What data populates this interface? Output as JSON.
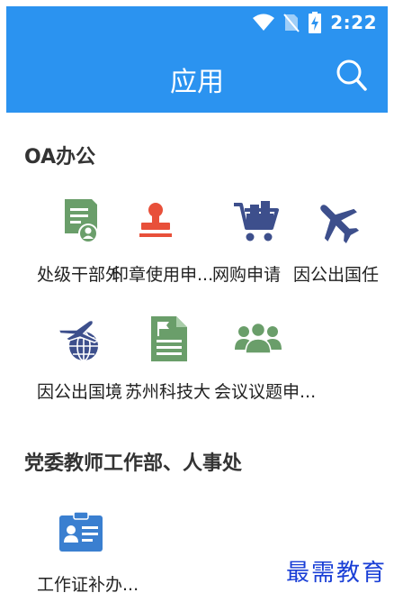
{
  "status": {
    "time": "2:22"
  },
  "header": {
    "title": "应用"
  },
  "sections": [
    {
      "title": "OA办公",
      "items": [
        {
          "label": "处级干部外",
          "icon": "certificate-icon"
        },
        {
          "label": "印章使用申...",
          "icon": "stamp-icon"
        },
        {
          "label": "网购申请",
          "icon": "shopping-cart-icon"
        },
        {
          "label": "因公出国任",
          "icon": "airplane-icon"
        },
        {
          "label": "因公出国境",
          "icon": "travel-globe-icon"
        },
        {
          "label": "苏州科技大",
          "icon": "document-flag-icon"
        },
        {
          "label": "会议议题申...",
          "icon": "meeting-people-icon"
        }
      ]
    },
    {
      "title": "党委教师工作部、人事处",
      "items": [
        {
          "label": "工作证补办...",
          "icon": "id-card-icon"
        }
      ]
    }
  ],
  "watermark": "最需教育",
  "colors": {
    "primary": "#2b93f0",
    "green": "#6a9e6a",
    "red": "#e8503a",
    "navy": "#3d4f8c",
    "blue": "#3a7fd0"
  }
}
